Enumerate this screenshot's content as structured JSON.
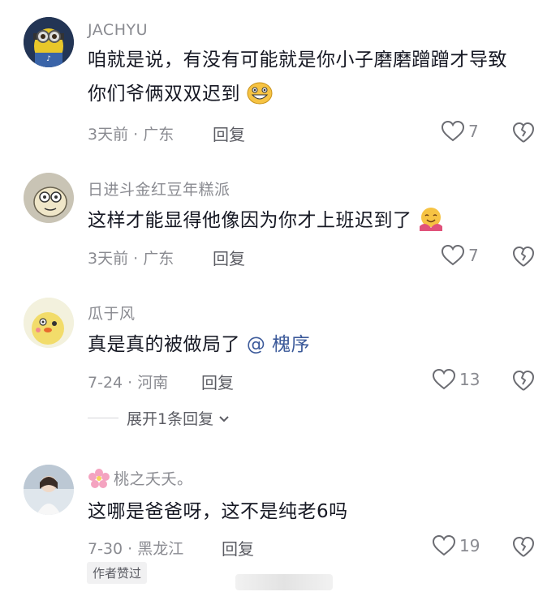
{
  "comments": [
    {
      "username": "JACHYU",
      "text": "咱就是说，有没有可能就是你小子磨磨蹭蹭才导致你们爷俩双双迟到",
      "meta": "3天前 · 广东",
      "reply": "回复",
      "likes": "7"
    },
    {
      "username": "日进斗金红豆年糕派",
      "text": "这样才能显得他像因为你才上班迟到了",
      "meta": "3天前 · 广东",
      "reply": "回复",
      "likes": "7"
    },
    {
      "username": "瓜于风",
      "text": "真是真的被做局了",
      "mention": "@ 槐序",
      "meta": "7-24 · 河南",
      "reply": "回复",
      "likes": "13",
      "expand": "展开1条回复"
    },
    {
      "username": "桃之夭夭。",
      "text": "这哪是爸爸呀，这不是纯老6吗",
      "meta": "7-30 · 黑龙江",
      "reply": "回复",
      "likes": "19",
      "badge": "作者赞过"
    }
  ],
  "icons": {
    "like": "heart-outline-icon",
    "dislike": "broken-heart-icon",
    "expand": "chevron-down-icon",
    "emoji1": "grinning-emoji-icon",
    "emoji2": "hug-emoji-icon",
    "username_prefix": "cherry-blossom-icon"
  },
  "colors": {
    "mention": "#3c5a9a",
    "meta": "#8a8b91",
    "text": "#161823"
  }
}
